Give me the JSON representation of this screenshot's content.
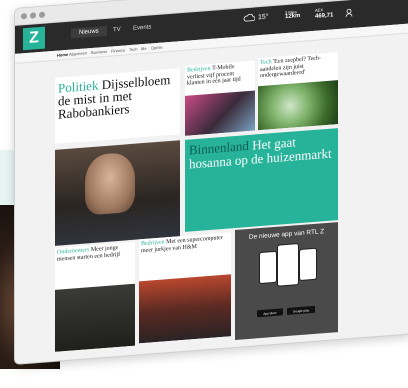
{
  "nav": {
    "tabs": [
      "Nieuws",
      "TV",
      "Events"
    ],
    "active_tab": "Nieuws",
    "sub_items": [
      "Home",
      "Algemeen",
      "Business",
      "Finance",
      "Tech",
      "Me",
      "Opinie"
    ]
  },
  "status": {
    "temperature": "15°",
    "files_label": "3 Files",
    "files_value": "12km",
    "aex_label": "AEX",
    "aex_value": "469,71",
    "user_icon": "user-icon"
  },
  "articles": [
    {
      "category": "Politiek",
      "title": "Dijsselbloem de mist in met Rabobankiers"
    },
    {
      "category": "Bedrijven",
      "title": "T-Mobile verliest vijf procent klanten in één jaar tijd"
    },
    {
      "category": "Tech",
      "title": "'Een zeepbel? Tech-aandelen zijn juist ondergewaardeerd'"
    },
    {
      "category": "Binnenland",
      "title": "Het gaat hosanna op de huizenmarkt"
    },
    {
      "category": "Ondernemers",
      "title": "Meer jonge mensen starten een bedrijf"
    },
    {
      "category": "Bedrijven",
      "title": "Met een supercomputer meer jurkjes van H&M"
    }
  ],
  "promo": {
    "title": "De nieuwe app van RTL Z",
    "app_store": "App Store",
    "google_play": "Google play"
  },
  "colors": {
    "brand": "#26b39a",
    "topbar": "#2a2a2a",
    "promo": "#4a4a4a"
  }
}
